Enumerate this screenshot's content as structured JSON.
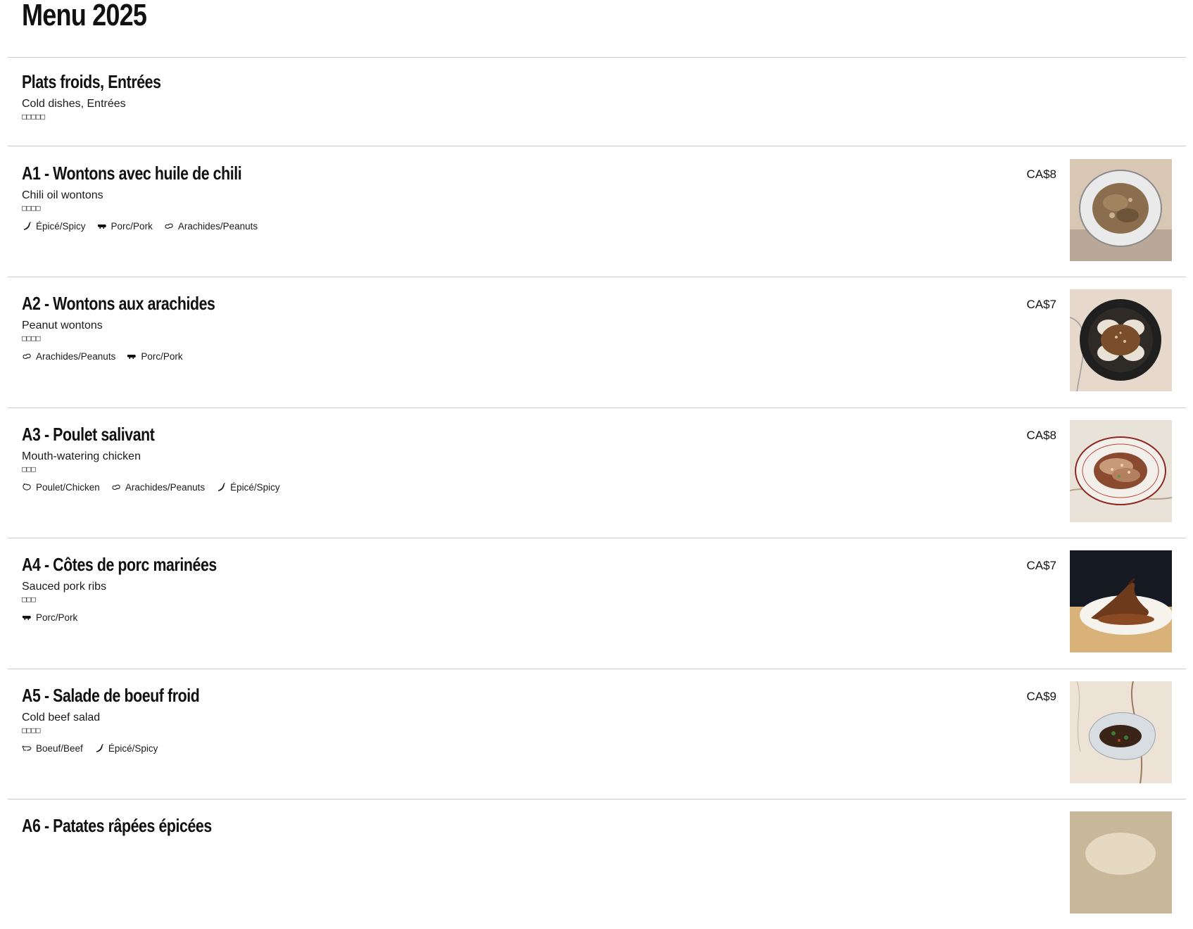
{
  "page": {
    "title": "Menu 2025"
  },
  "section": {
    "title_fr": "Plats froids, Entrées",
    "title_en": "Cold dishes, Entrées",
    "title_cn": "□□□□□"
  },
  "items": [
    {
      "title": "A1 - Wontons avec huile de chili",
      "subtitle": "Chili oil wontons",
      "cn": "□□□□",
      "price": "CA$8",
      "tags": [
        {
          "label": "Épicé/Spicy",
          "icon": "chili-icon"
        },
        {
          "label": "Porc/Pork",
          "icon": "pig-icon"
        },
        {
          "label": "Arachides/Peanuts",
          "icon": "peanut-icon"
        }
      ],
      "photo": "chili-oil-wontons-photo"
    },
    {
      "title": "A2 - Wontons aux arachides",
      "subtitle": "Peanut wontons",
      "cn": "□□□□",
      "price": "CA$7",
      "tags": [
        {
          "label": "Arachides/Peanuts",
          "icon": "peanut-icon"
        },
        {
          "label": "Porc/Pork",
          "icon": "pig-icon"
        }
      ],
      "photo": "peanut-wontons-photo"
    },
    {
      "title": "A3 - Poulet salivant",
      "subtitle": "Mouth-watering chicken",
      "cn": "□□□",
      "price": "CA$8",
      "tags": [
        {
          "label": "Poulet/Chicken",
          "icon": "chicken-icon"
        },
        {
          "label": "Arachides/Peanuts",
          "icon": "peanut-icon"
        },
        {
          "label": "Épicé/Spicy",
          "icon": "chili-icon"
        }
      ],
      "photo": "mouth-watering-chicken-photo"
    },
    {
      "title": "A4 - Côtes de porc marinées",
      "subtitle": "Sauced pork ribs",
      "cn": "□□□",
      "price": "CA$7",
      "tags": [
        {
          "label": "Porc/Pork",
          "icon": "pig-icon"
        }
      ],
      "photo": "sauced-pork-ribs-photo"
    },
    {
      "title": "A5 - Salade de boeuf froid",
      "subtitle": "Cold beef salad",
      "cn": "□□□□",
      "price": "CA$9",
      "tags": [
        {
          "label": "Boeuf/Beef",
          "icon": "cow-icon"
        },
        {
          "label": "Épicé/Spicy",
          "icon": "chili-icon"
        }
      ],
      "photo": "cold-beef-salad-photo"
    },
    {
      "title": "A6 - Patates râpées épicées",
      "subtitle": "",
      "cn": "",
      "price": "",
      "tags": [],
      "photo": "next-item-photo"
    }
  ],
  "colors": {
    "divider": "#c9c9c9",
    "text": "#111111"
  }
}
